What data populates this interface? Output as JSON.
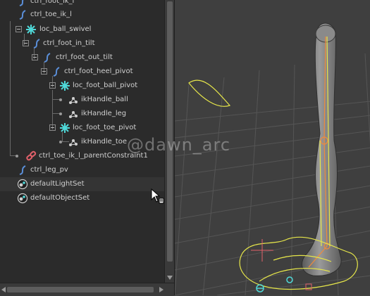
{
  "outliner": {
    "items": [
      {
        "label": "ctrl_foot_ik_l",
        "icon": "curve-icon"
      },
      {
        "label": "ctrl_toe_ik_l",
        "icon": "curve-icon"
      },
      {
        "label": "loc_ball_swivel",
        "icon": "locator-icon"
      },
      {
        "label": "ctrl_foot_in_tilt",
        "icon": "curve-icon"
      },
      {
        "label": "ctrl_foot_out_tilt",
        "icon": "curve-icon"
      },
      {
        "label": "ctrl_foot_heel_pivot",
        "icon": "curve-icon"
      },
      {
        "label": "loc_foot_ball_pivot",
        "icon": "locator-icon"
      },
      {
        "label": "ikHandle_ball",
        "icon": "ik-handle-icon"
      },
      {
        "label": "ikHandle_leg",
        "icon": "ik-handle-icon"
      },
      {
        "label": "loc_foot_toe_pivot",
        "icon": "locator-icon"
      },
      {
        "label": "ikHandle_toe",
        "icon": "ik-handle-icon"
      },
      {
        "label": "ctrl_toe_ik_l_parentConstraint1",
        "icon": "constraint-icon"
      },
      {
        "label": "ctrl_leg_pv",
        "icon": "curve-icon"
      },
      {
        "label": "defaultLightSet",
        "icon": "set-icon"
      },
      {
        "label": "defaultObjectSet",
        "icon": "set-icon"
      }
    ]
  },
  "viewport": {
    "watermark": "@dawn_arc"
  },
  "colors": {
    "outliner_bg": "#2b2b2b",
    "viewport_bg": "#3f3f3f",
    "locator": "#4fd8d8",
    "curve": "#5b8fd9",
    "constraint": "#e0606a",
    "control_yellow": "#e6e64a",
    "joint_orange": "#f08a3c"
  }
}
